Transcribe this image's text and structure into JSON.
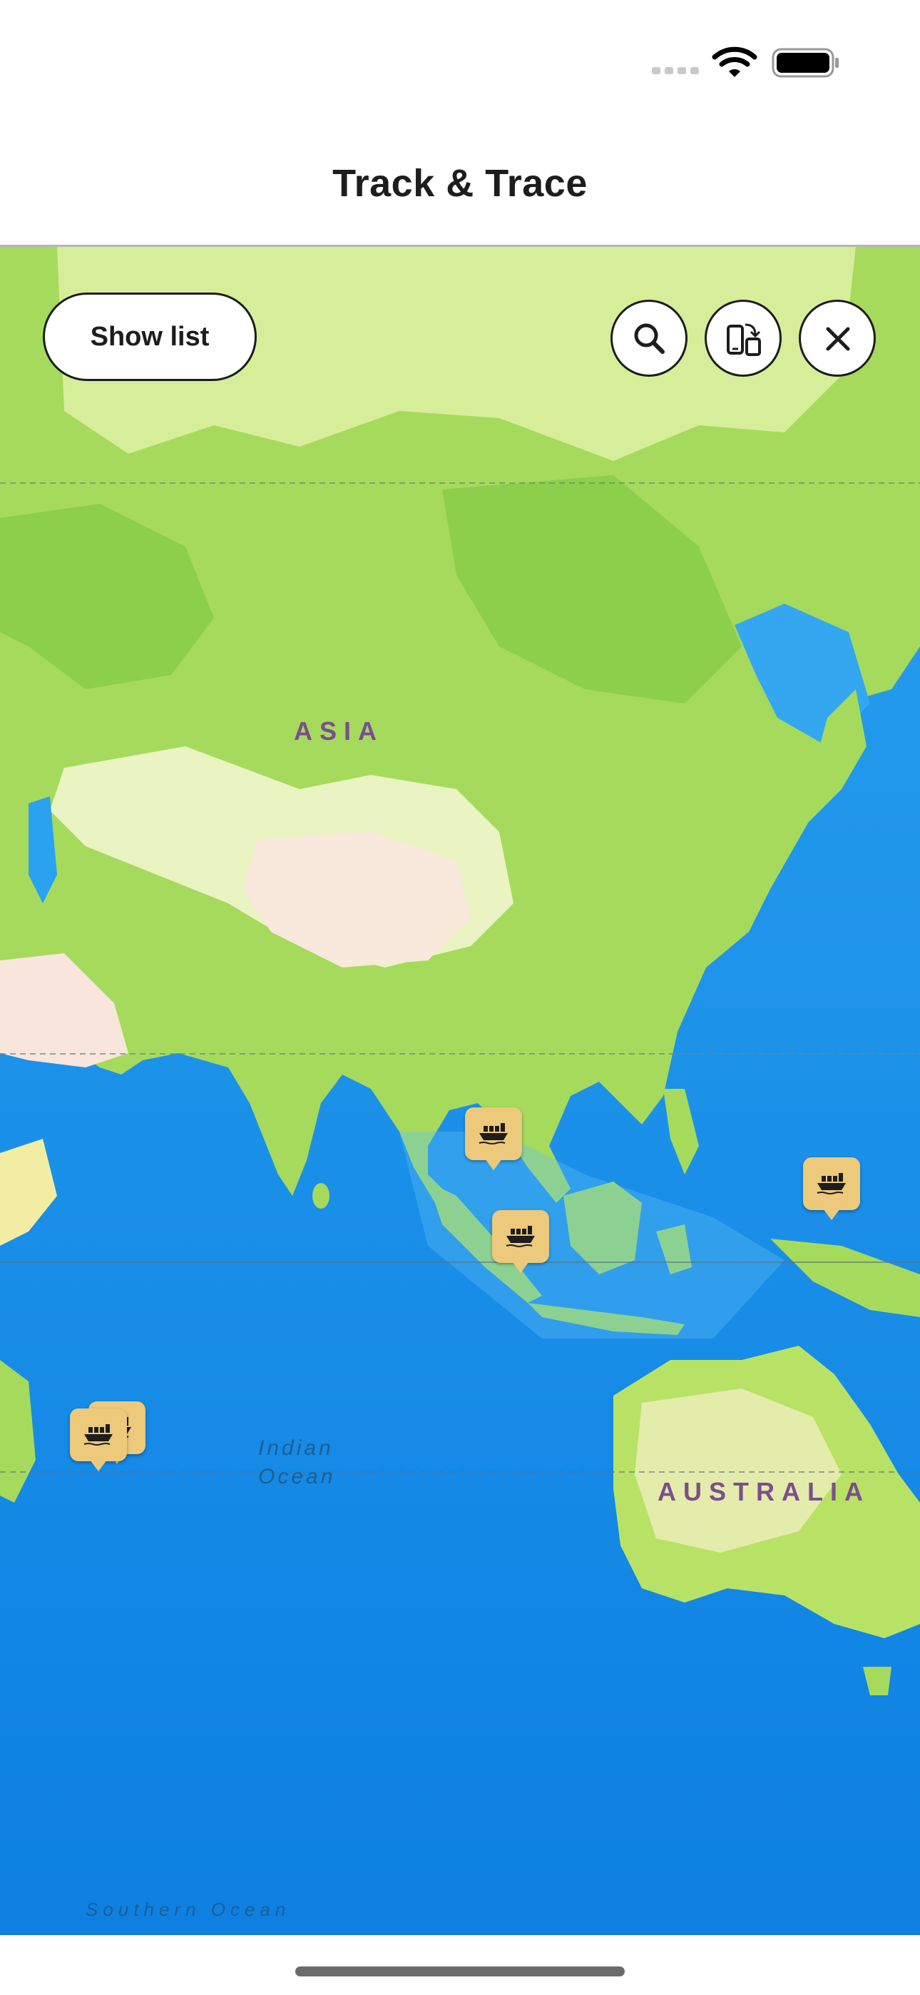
{
  "status_bar": {
    "icons": [
      "signal-icon",
      "wifi-icon",
      "battery-icon"
    ]
  },
  "header": {
    "title": "Track & Trace"
  },
  "map": {
    "controls": {
      "show_list_label": "Show list",
      "search_icon": "search-icon",
      "device_switch_icon": "device-switch-icon",
      "close_icon": "close-icon"
    },
    "labels": {
      "asia": "ASIA",
      "australia": "AUSTRALIA",
      "indian_ocean_line1": "Indian",
      "indian_ocean_line2": "Ocean",
      "southern_ocean": "Southern Ocean"
    },
    "markers": [
      {
        "icon": "ship-icon"
      },
      {
        "icon": "ship-icon"
      },
      {
        "icon": "ship-icon"
      },
      {
        "icon": "ship-icon"
      },
      {
        "icon": "ship-icon"
      }
    ],
    "colors": {
      "ocean": "#0f84e6",
      "land_green": "#a8dc5a",
      "land_light": "#d9ef9c",
      "desert": "#f7ead6",
      "marker": "#ecc97b",
      "label": "#7b4f8b"
    }
  }
}
